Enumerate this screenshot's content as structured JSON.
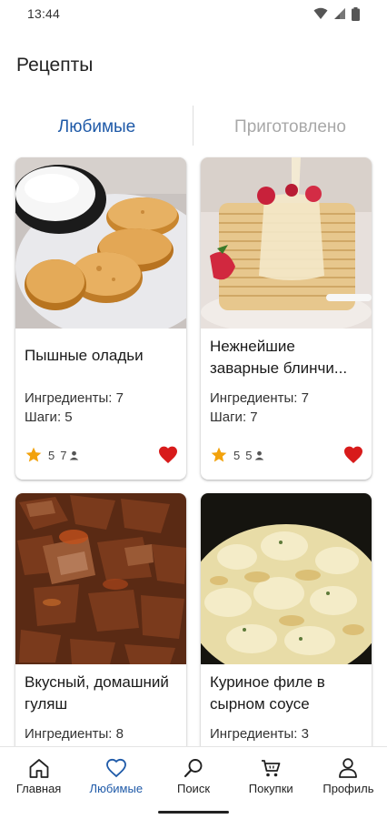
{
  "status_bar": {
    "time": "13:44"
  },
  "header": {
    "title": "Рецепты"
  },
  "tabs": [
    {
      "label": "Любимые",
      "active": true
    },
    {
      "label": "Приготовлено",
      "active": false
    }
  ],
  "recipes": [
    {
      "title": "Пышные оладьи",
      "ingredients": "Ингредиенты: 7",
      "steps": "Шаги: 5",
      "rating": "5",
      "users": "7",
      "favorite": true
    },
    {
      "title": "Нежнейшие заварные блинчи...",
      "ingredients": "Ингредиенты: 7",
      "steps": "Шаги: 7",
      "rating": "5",
      "users": "5",
      "favorite": true
    },
    {
      "title": "Вкусный, домашний гуляш",
      "ingredients": "Ингредиенты: 8",
      "steps": "",
      "rating": "",
      "users": "",
      "favorite": true
    },
    {
      "title": "Куриное филе в сырном соусе",
      "ingredients": "Ингредиенты: 3",
      "steps": "",
      "rating": "",
      "users": "",
      "favorite": true
    }
  ],
  "bottom_nav": [
    {
      "label": "Главная",
      "icon": "home-icon",
      "active": false
    },
    {
      "label": "Любимые",
      "icon": "heart-outline-icon",
      "active": true
    },
    {
      "label": "Поиск",
      "icon": "search-icon",
      "active": false
    },
    {
      "label": "Покупки",
      "icon": "cart-icon",
      "active": false
    },
    {
      "label": "Профиль",
      "icon": "profile-icon",
      "active": false
    }
  ],
  "colors": {
    "accent": "#1f5aa8",
    "heart": "#d81b1b",
    "star": "#f2a20c",
    "inactive_tab": "#a8a8a8"
  }
}
